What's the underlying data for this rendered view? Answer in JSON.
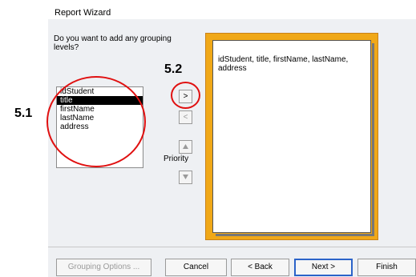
{
  "window": {
    "title": "Report Wizard"
  },
  "prompt": "Do you want to add any grouping levels?",
  "fields": [
    "idStudent",
    "title",
    "firstName",
    "lastName",
    "address"
  ],
  "selected_field": "title",
  "side_buttons": {
    "add": ">",
    "remove": "<",
    "priority_up_icon": "up-arrow-icon",
    "priority_down_icon": "down-arrow-icon",
    "priority_label": "Priority"
  },
  "preview": {
    "text": "idStudent, title, firstName, lastName, address"
  },
  "buttons": {
    "grouping_options": "Grouping Options ...",
    "cancel": "Cancel",
    "back": "< Back",
    "next": "Next >",
    "finish": "Finish"
  },
  "annotations": {
    "step_1": "5.1",
    "step_2": "5.2"
  },
  "colors": {
    "annotation": "#e01010",
    "preview_border": "#f0a818",
    "selection": "#000000",
    "default_button": "#2b63c9"
  }
}
